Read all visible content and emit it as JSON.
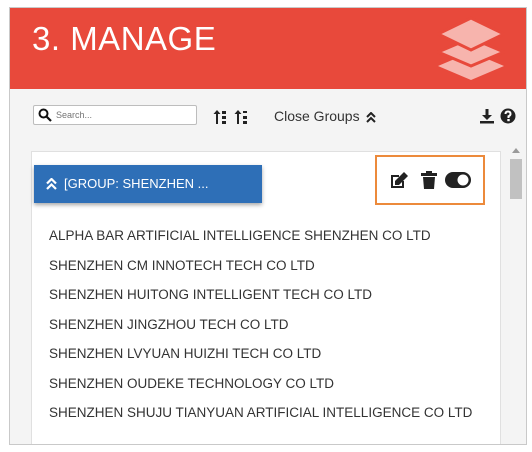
{
  "header": {
    "title": "3. MANAGE",
    "icon": "layers-icon",
    "bg_color": "#e8493b"
  },
  "toolbar": {
    "search_placeholder": "Search...",
    "search_value": "",
    "sort_icons": [
      "sort-asc-icon",
      "sort-desc-icon"
    ],
    "close_groups_label": "Close Groups",
    "download_icon": "download-icon",
    "help_icon": "help-icon"
  },
  "group": {
    "label": "[GROUP: SHENZHEN ...",
    "color": "#2e6fb7",
    "actions": [
      "edit-icon",
      "trash-icon",
      "toggle-icon"
    ],
    "highlight_color": "#ec8a3b"
  },
  "companies": [
    "ALPHA BAR ARTIFICIAL INTELLIGENCE SHENZHEN CO LTD",
    "SHENZHEN CM INNOTECH TECH CO LTD",
    "SHENZHEN HUITONG INTELLIGENT TECH CO LTD",
    "SHENZHEN JINGZHOU TECH CO LTD",
    "SHENZHEN LVYUAN HUIZHI TECH CO LTD",
    "SHENZHEN OUDEKE TECHNOLOGY CO LTD",
    "SHENZHEN SHUJU TIANYUAN ARTIFICIAL INTELLIGENCE CO LTD"
  ]
}
